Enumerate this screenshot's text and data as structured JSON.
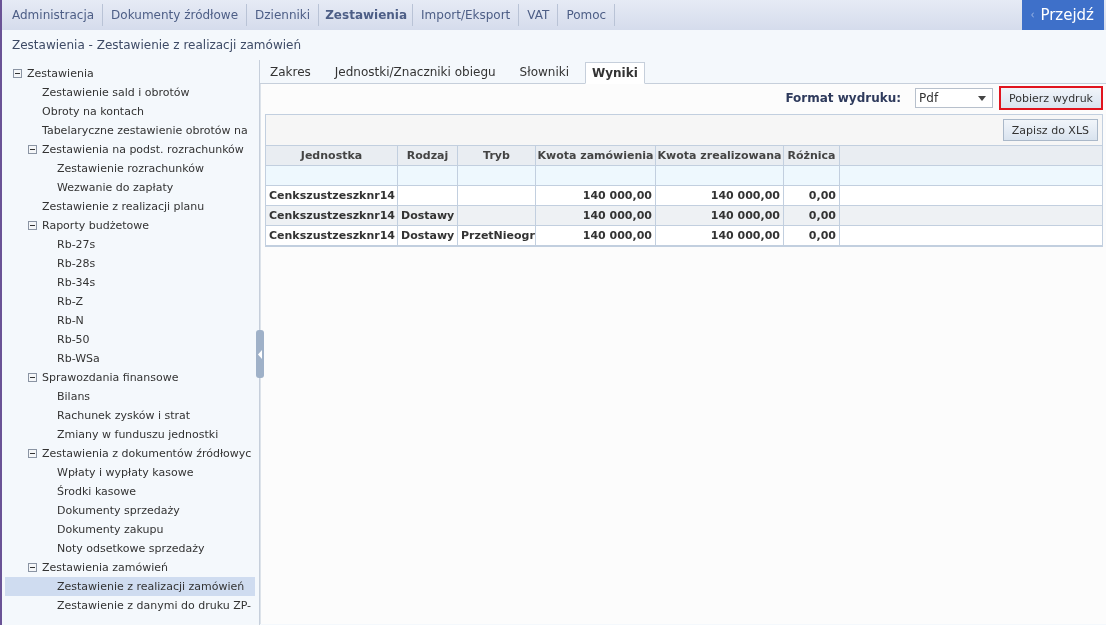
{
  "nav": {
    "items": [
      {
        "label": "Administracja",
        "selected": false
      },
      {
        "label": "Dokumenty źródłowe",
        "selected": false
      },
      {
        "label": "Dzienniki",
        "selected": false
      },
      {
        "label": "Zestawienia",
        "selected": true
      },
      {
        "label": "Import/Eksport",
        "selected": false
      },
      {
        "label": "VAT",
        "selected": false
      },
      {
        "label": "Pomoc",
        "selected": false
      }
    ],
    "go_button": "Przejdź"
  },
  "breadcrumb": "Zestawienia - Zestawienie z realizacji zamówień",
  "tree": [
    {
      "label": "Zestawienia",
      "expanded": true,
      "selected": false,
      "children": [
        {
          "label": "Zestawienie sald i obrotów",
          "selected": false
        },
        {
          "label": "Obroty na kontach",
          "selected": false
        },
        {
          "label": "Tabelaryczne zestawienie obrotów na",
          "selected": false
        },
        {
          "label": "Zestawienia na podst. rozrachunków",
          "expanded": true,
          "selected": false,
          "children": [
            {
              "label": "Zestawienie rozrachunków",
              "selected": false
            },
            {
              "label": "Wezwanie do zapłaty",
              "selected": false
            }
          ]
        },
        {
          "label": "Zestawienie z realizacji planu",
          "selected": false
        },
        {
          "label": "Raporty budżetowe",
          "expanded": true,
          "selected": false,
          "children": [
            {
              "label": "Rb-27s",
              "selected": false
            },
            {
              "label": "Rb-28s",
              "selected": false
            },
            {
              "label": "Rb-34s",
              "selected": false
            },
            {
              "label": "Rb-Z",
              "selected": false
            },
            {
              "label": "Rb-N",
              "selected": false
            },
            {
              "label": "Rb-50",
              "selected": false
            },
            {
              "label": "Rb-WSa",
              "selected": false
            }
          ]
        },
        {
          "label": "Sprawozdania finansowe",
          "expanded": true,
          "selected": false,
          "children": [
            {
              "label": "Bilans",
              "selected": false
            },
            {
              "label": "Rachunek zysków i strat",
              "selected": false
            },
            {
              "label": "Zmiany w funduszu jednostki",
              "selected": false
            }
          ]
        },
        {
          "label": "Zestawienia z dokumentów źródłowyc",
          "expanded": true,
          "selected": false,
          "children": [
            {
              "label": "Wpłaty i wypłaty kasowe",
              "selected": false
            },
            {
              "label": "Środki kasowe",
              "selected": false
            },
            {
              "label": "Dokumenty sprzedaży",
              "selected": false
            },
            {
              "label": "Dokumenty zakupu",
              "selected": false
            },
            {
              "label": "Noty odsetkowe sprzedaży",
              "selected": false
            }
          ]
        },
        {
          "label": "Zestawienia zamówień",
          "expanded": true,
          "selected": false,
          "children": [
            {
              "label": "Zestawienie z realizacji zamówień",
              "selected": true
            },
            {
              "label": "Zestawienie z danymi do druku ZP-",
              "selected": false
            }
          ]
        }
      ]
    }
  ],
  "tabs": [
    {
      "label": "Zakres",
      "selected": false
    },
    {
      "label": "Jednostki/Znaczniki obiegu",
      "selected": false
    },
    {
      "label": "Słowniki",
      "selected": false
    },
    {
      "label": "Wyniki",
      "selected": true
    }
  ],
  "print_format": {
    "label": "Format wydruku:",
    "value": "Pdf"
  },
  "download_button": {
    "label": "Pobierz wydruk",
    "highlighted": true
  },
  "export_button": "Zapisz do XLS",
  "table": {
    "columns": [
      "Jednostka",
      "Rodzaj",
      "Tryb",
      "Kwota zamówienia",
      "Kwota zrealizowana",
      "Różnica"
    ],
    "rows": [
      [
        "Cenkszustzeszknr14",
        "",
        "",
        "140 000,00",
        "140 000,00",
        "0,00"
      ],
      [
        "Cenkszustzeszknr14",
        "Dostawy",
        "",
        "140 000,00",
        "140 000,00",
        "0,00"
      ],
      [
        "Cenkszustzeszknr14",
        "Dostawy",
        "PrzetNieogr",
        "140 000,00",
        "140 000,00",
        "0,00"
      ]
    ]
  }
}
